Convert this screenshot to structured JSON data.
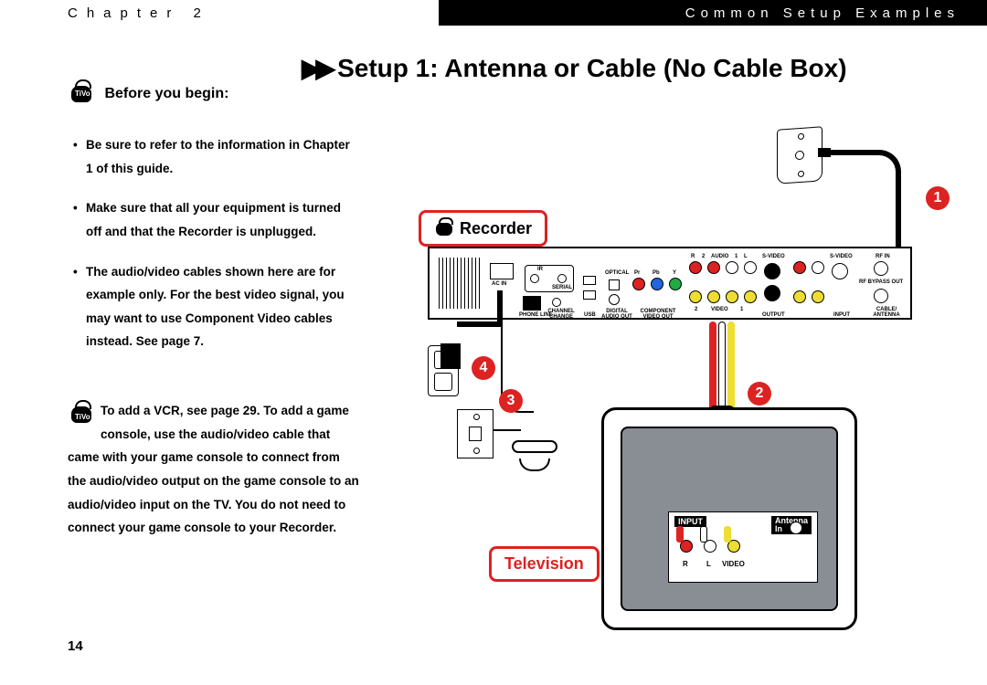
{
  "header": {
    "chapter": "Chapter 2",
    "breadcrumb": "Common Setup Examples"
  },
  "title": "Setup 1: Antenna or Cable (No Cable Box)",
  "sidebar": {
    "heading": "Before you begin:",
    "bullets": [
      "Be sure to refer to the information in Chapter 1 of this guide.",
      "Make sure that all your equipment is turned off and that the Recorder is unplugged.",
      "The audio/video cables shown here are for example only. For the best video signal, you may want to use Component Video cables instead. See page 7."
    ],
    "tip": "To add a VCR, see page 29. To add a game console, use the audio/video cable that came with your game console to connect from the audio/video output on the game console to an audio/video input on the TV. You do not need to connect your game console to your Recorder."
  },
  "diagram": {
    "labels": {
      "recorder": "Recorder",
      "television": "Television"
    },
    "callouts": [
      "1",
      "2",
      "3",
      "4"
    ],
    "recorder_ports": {
      "ac_in": "AC IN",
      "ir": "IR",
      "serial": "SERIAL",
      "phone_line": "PHONE LINE",
      "channel_change": "CHANNEL CHANGE",
      "usb": "USB",
      "optical": "OPTICAL",
      "digital_audio_out": "DIGITAL AUDIO OUT",
      "pr": "Pr",
      "pb": "Pb",
      "y": "Y",
      "component_video_out": "COMPONENT VIDEO OUT",
      "r": "R",
      "l": "L",
      "audio2": "2",
      "audio_lbl": "AUDIO",
      "audio1": "1",
      "video2": "2",
      "video_lbl": "VIDEO",
      "video1": "1",
      "s_video": "S-VIDEO",
      "output": "OUTPUT",
      "s_video2": "S-VIDEO",
      "input": "INPUT",
      "rf_in": "RF IN",
      "rf_bypass_out": "RF BYPASS OUT",
      "cable_antenna": "CABLE/ ANTENNA"
    },
    "tv_panel": {
      "input": "INPUT",
      "antenna_in": "Antenna In",
      "r": "R",
      "l": "L",
      "video": "VIDEO"
    }
  },
  "page_number": "14"
}
